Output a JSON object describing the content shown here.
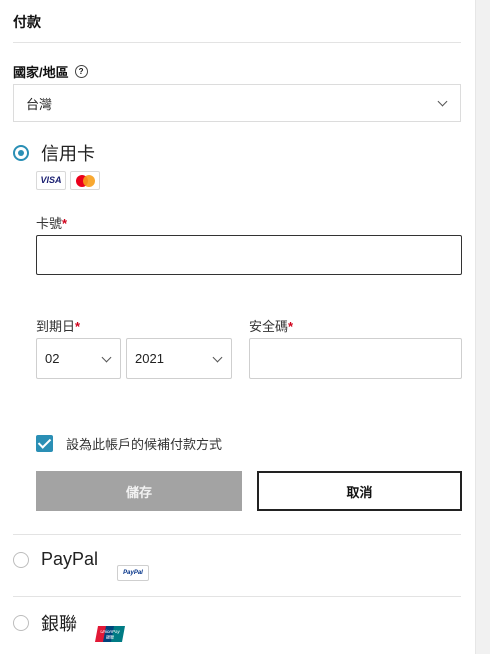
{
  "section": {
    "title": "付款"
  },
  "country": {
    "label": "國家/地區",
    "help_icon": "?",
    "selected": "台灣"
  },
  "credit_card": {
    "label": "信用卡",
    "logos": {
      "visa": "VISA"
    },
    "card_number_label": "卡號",
    "expiry_label": "到期日",
    "cvv_label": "安全碼",
    "required_mark": "*",
    "expiry_month": "02",
    "expiry_year": "2021",
    "save_as_backup_label": "設為此帳戶的候補付款方式",
    "save_button": "儲存",
    "cancel_button": "取消"
  },
  "paypal": {
    "label": "PayPal",
    "logo_text": "PayPal"
  },
  "unionpay": {
    "label": "銀聯",
    "logo_text": "UnionPay 銀聯"
  },
  "colors": {
    "accent": "#2a8fb5",
    "required": "#d0021b",
    "save_button": "#a3a3a3"
  }
}
